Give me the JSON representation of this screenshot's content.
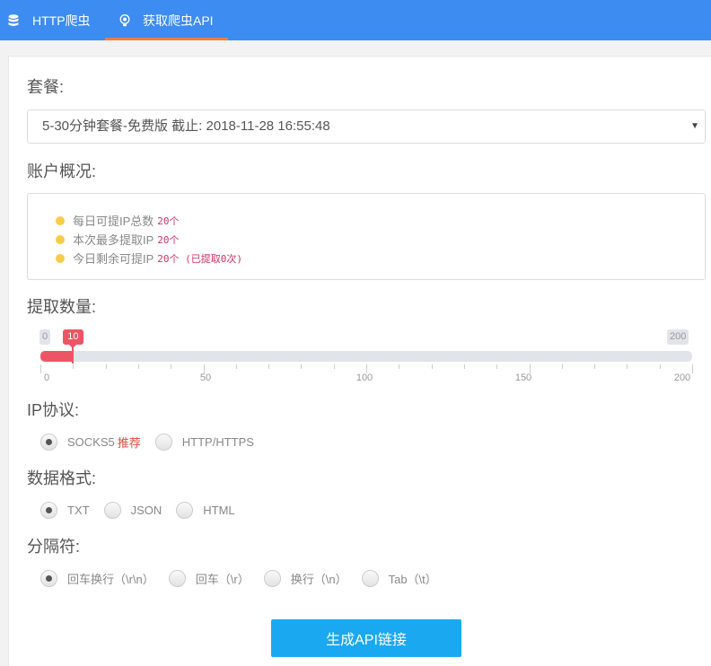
{
  "tabs": [
    {
      "label": "HTTP爬虫",
      "icon": "database-icon"
    },
    {
      "label": "获取爬虫API",
      "icon": "lightbulb-icon",
      "active": true
    }
  ],
  "package": {
    "label": "套餐:",
    "selected": "5-30分钟套餐-免费版 截止: 2018-11-28 16:55:48"
  },
  "account": {
    "label": "账户概况:",
    "items": [
      {
        "text": "每日可提IP总数",
        "value": "20个"
      },
      {
        "text": "本次最多提取IP",
        "value": "20个"
      },
      {
        "text": "今日剩余可提IP",
        "value": "20个 (已提取0次)"
      }
    ]
  },
  "quantity": {
    "label": "提取数量:",
    "min_label": "0",
    "max_label": "200",
    "current_label": "10",
    "min": 0,
    "max": 200,
    "value": 10,
    "scale": [
      "0",
      "50",
      "100",
      "150",
      "200"
    ]
  },
  "protocol": {
    "label": "IP协议:",
    "options": [
      {
        "label": "SOCKS5",
        "tag": "推荐",
        "checked": true
      },
      {
        "label": "HTTP/HTTPS",
        "checked": false
      }
    ]
  },
  "format": {
    "label": "数据格式:",
    "options": [
      {
        "label": "TXT",
        "checked": true
      },
      {
        "label": "JSON",
        "checked": false
      },
      {
        "label": "HTML",
        "checked": false
      }
    ]
  },
  "separator": {
    "label": "分隔符:",
    "options": [
      {
        "label": "回车换行（\\r\\n）",
        "checked": true
      },
      {
        "label": "回车（\\r）",
        "checked": false
      },
      {
        "label": "换行（\\n）",
        "checked": false
      },
      {
        "label": "Tab（\\t）",
        "checked": false
      }
    ]
  },
  "generate_button": "生成API链接",
  "colors": {
    "topbar": "#3c8cf2",
    "tab_underline": "#f07c48",
    "slider_fill": "#ed5565",
    "bullet": "#f7cc4b",
    "button": "#1aa9f0"
  }
}
